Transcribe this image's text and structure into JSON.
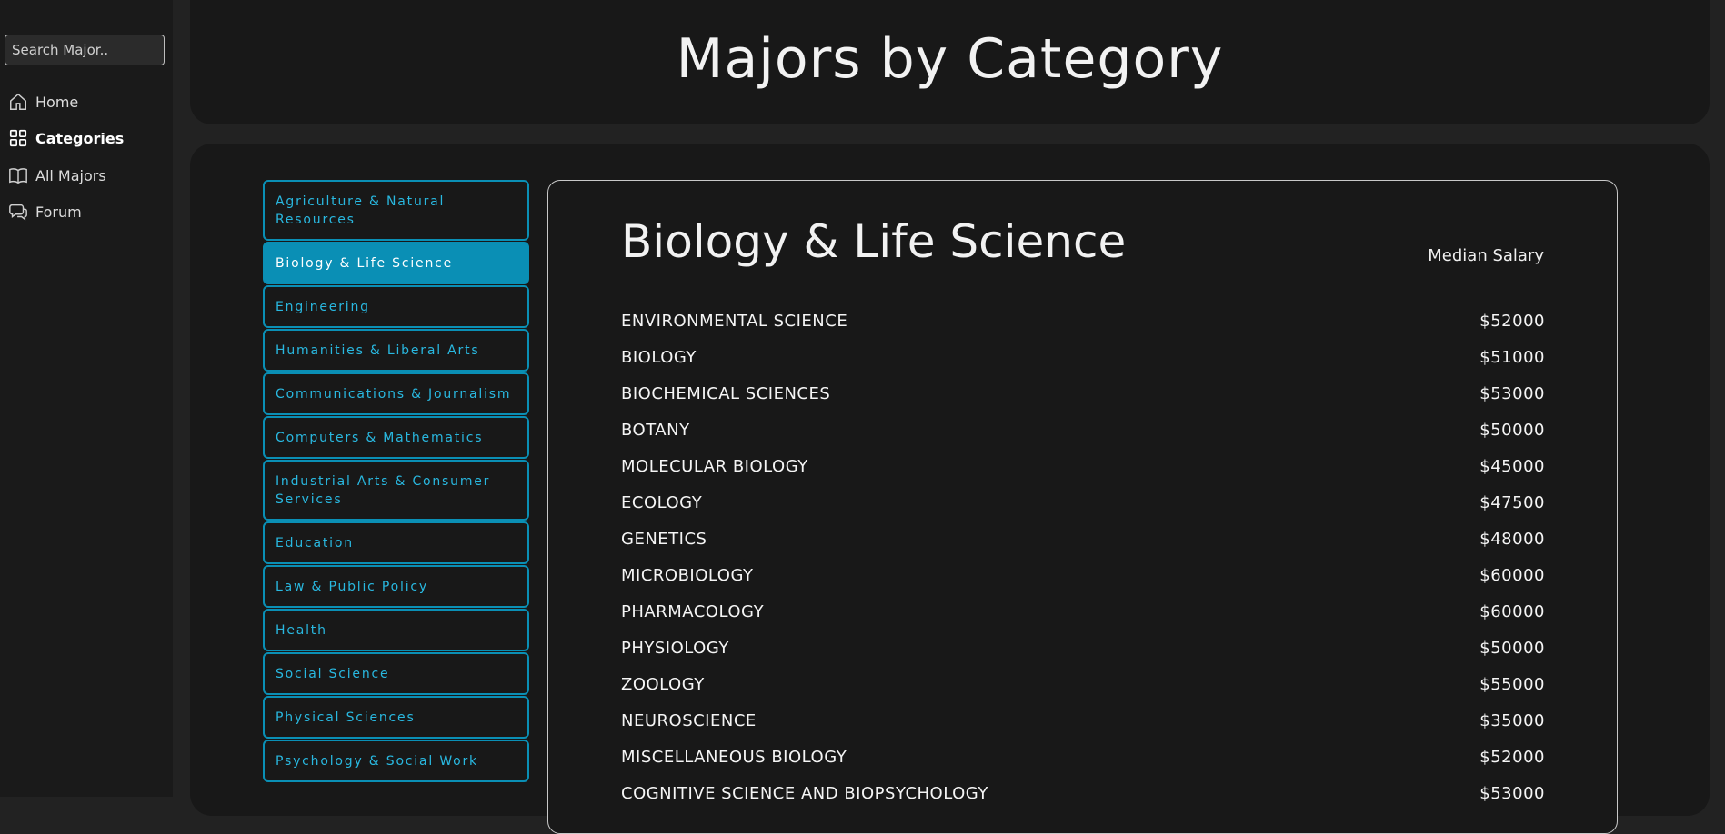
{
  "sidebar": {
    "search_placeholder": "Search Major..",
    "items": [
      {
        "label": "Home"
      },
      {
        "label": "Categories"
      },
      {
        "label": "All Majors"
      },
      {
        "label": "Forum"
      }
    ]
  },
  "header": {
    "title": "Majors by Category"
  },
  "categories": [
    "Agriculture & Natural Resources",
    "Biology & Life Science",
    "Engineering",
    "Humanities & Liberal Arts",
    "Communications & Journalism",
    "Computers & Mathematics",
    "Industrial Arts & Consumer Services",
    "Education",
    "Law & Public Policy",
    "Health",
    "Social Science",
    "Physical Sciences",
    "Psychology & Social Work"
  ],
  "selected_category": "Biology & Life Science",
  "detail": {
    "title": "Biology & Life Science",
    "salary_header": "Median Salary",
    "rows": [
      {
        "major": "ENVIRONMENTAL SCIENCE",
        "salary": "$52000"
      },
      {
        "major": "BIOLOGY",
        "salary": "$51000"
      },
      {
        "major": "BIOCHEMICAL SCIENCES",
        "salary": "$53000"
      },
      {
        "major": "BOTANY",
        "salary": "$50000"
      },
      {
        "major": "MOLECULAR BIOLOGY",
        "salary": "$45000"
      },
      {
        "major": "ECOLOGY",
        "salary": "$47500"
      },
      {
        "major": "GENETICS",
        "salary": "$48000"
      },
      {
        "major": "MICROBIOLOGY",
        "salary": "$60000"
      },
      {
        "major": "PHARMACOLOGY",
        "salary": "$60000"
      },
      {
        "major": "PHYSIOLOGY",
        "salary": "$50000"
      },
      {
        "major": "ZOOLOGY",
        "salary": "$55000"
      },
      {
        "major": "NEUROSCIENCE",
        "salary": "$35000"
      },
      {
        "major": "MISCELLANEOUS BIOLOGY",
        "salary": "$52000"
      },
      {
        "major": "COGNITIVE SCIENCE AND BIOPSYCHOLOGY",
        "salary": "$53000"
      }
    ]
  },
  "colors": {
    "accent": "#0a8fb5",
    "accent_text": "#29b8e0",
    "background": "#222222",
    "panel": "#181818"
  }
}
